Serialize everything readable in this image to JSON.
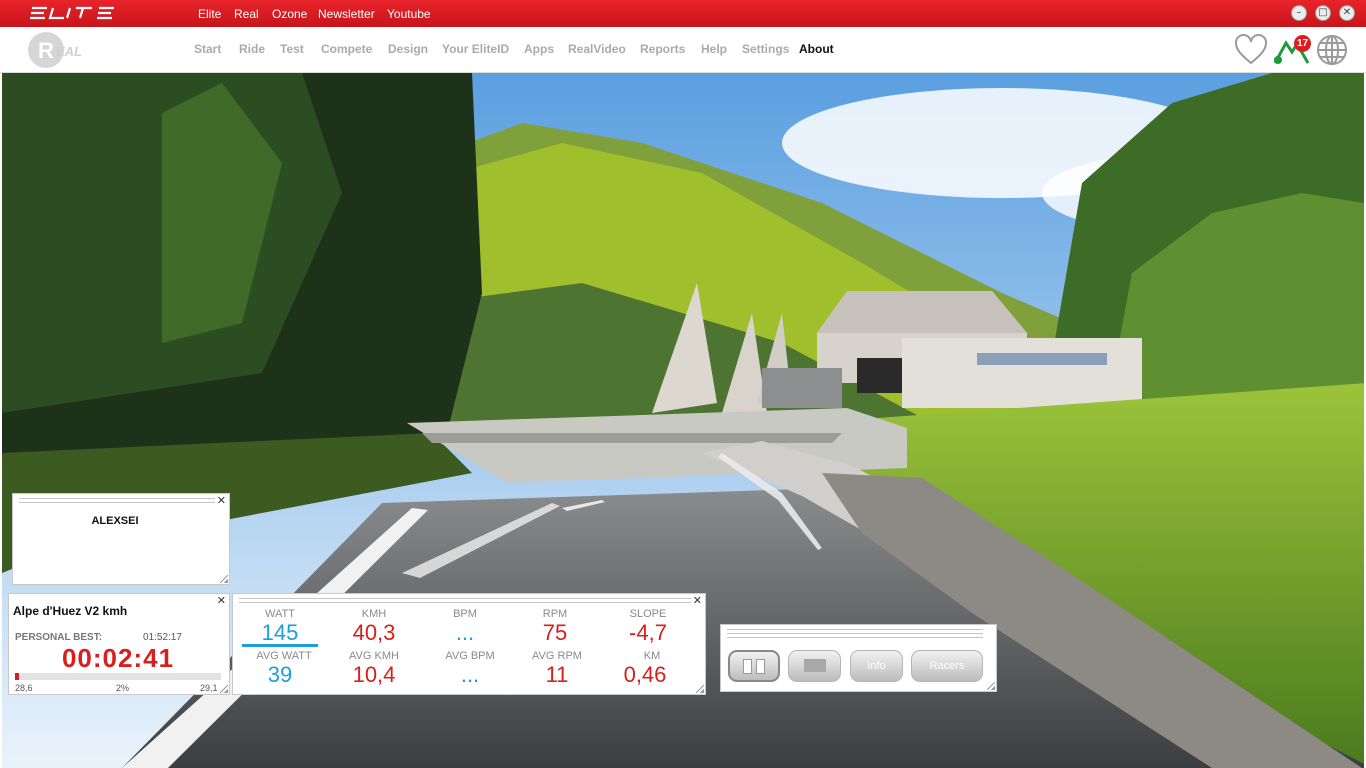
{
  "topbar": {
    "brand": "ELITE",
    "links": [
      "Elite",
      "Real",
      "Ozone",
      "Newsletter",
      "Youtube"
    ],
    "window_buttons": [
      "minimize-icon",
      "restore-icon",
      "close-icon"
    ]
  },
  "nav": {
    "logo": "REAL",
    "items": [
      "Start",
      "Ride",
      "Test",
      "Compete",
      "Design",
      "Your EliteID",
      "Apps",
      "RealVideo",
      "Reports",
      "Help",
      "Settings",
      "About"
    ],
    "active": "About",
    "notification_count": "17",
    "icons": [
      "heart-icon",
      "route-icon",
      "globe-icon"
    ]
  },
  "rider_panel": {
    "name": "ALEXSEI"
  },
  "course_panel": {
    "title": "Alpe d'Huez V2 kmh",
    "personal_best_label": "PERSONAL BEST:",
    "personal_best_time": "01:52:17",
    "elapsed": "00:02:41",
    "min_label": "28,6",
    "pct_label": "2%",
    "max_label": "29,1",
    "progress_fraction": 0.02
  },
  "metrics_panel": {
    "row1": [
      {
        "label": "WATT",
        "value": "145",
        "color": "blue"
      },
      {
        "label": "KMH",
        "value": "40,3",
        "color": "red"
      },
      {
        "label": "BPM",
        "value": "...",
        "color": "blue"
      },
      {
        "label": "RPM",
        "value": "75",
        "color": "red"
      },
      {
        "label": "SLOPE",
        "value": "-4,7",
        "color": "red"
      }
    ],
    "row2": [
      {
        "label": "AVG WATT",
        "value": "39",
        "color": "blue"
      },
      {
        "label": "AVG KMH",
        "value": "10,4",
        "color": "red"
      },
      {
        "label": "AVG BPM",
        "value": "...",
        "color": "blue"
      },
      {
        "label": "AVG RPM",
        "value": "11",
        "color": "red"
      },
      {
        "label": "KM",
        "value": "0,46",
        "color": "red"
      }
    ]
  },
  "controls_panel": {
    "buttons": [
      "pause-icon",
      "stop-icon",
      "Info",
      "Racers"
    ]
  },
  "colors": {
    "brand_red": "#d81e1e",
    "accent_blue": "#1a9fd8"
  }
}
